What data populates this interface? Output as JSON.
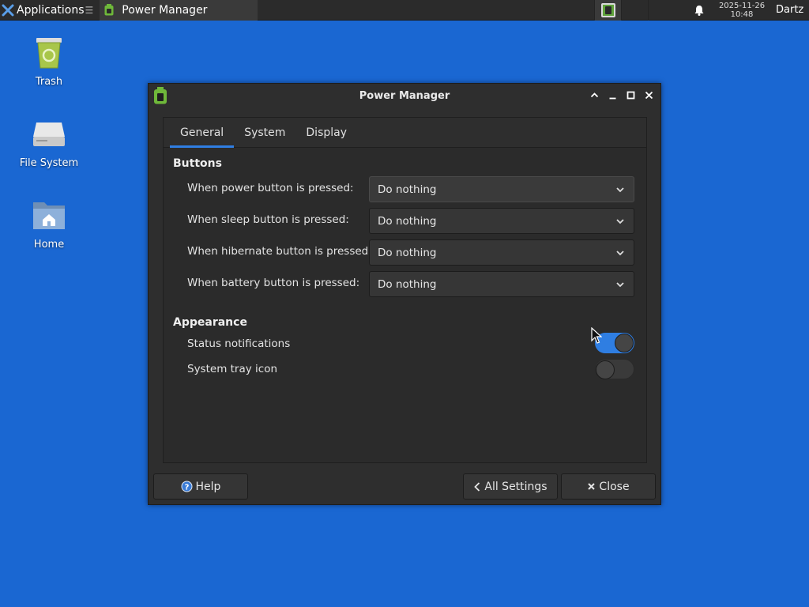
{
  "panel": {
    "applications_label": "Applications",
    "task_title": "Power Manager",
    "clock_date": "2025-11-26",
    "clock_time": "10:48",
    "user_name": "Dartz"
  },
  "desktop": {
    "icons": [
      {
        "label": "Trash"
      },
      {
        "label": "File System"
      },
      {
        "label": "Home"
      }
    ]
  },
  "window": {
    "title": "Power Manager",
    "tabs": [
      {
        "label": "General",
        "active": true
      },
      {
        "label": "System",
        "active": false
      },
      {
        "label": "Display",
        "active": false
      }
    ],
    "sections": {
      "buttons": {
        "title": "Buttons",
        "rows": [
          {
            "label": "When power button is pressed:",
            "value": "Do nothing"
          },
          {
            "label": "When sleep button is pressed:",
            "value": "Do nothing"
          },
          {
            "label": "When hibernate button is pressed:",
            "value": "Do nothing"
          },
          {
            "label": "When battery button is pressed:",
            "value": "Do nothing"
          }
        ]
      },
      "appearance": {
        "title": "Appearance",
        "rows": [
          {
            "label": "Status notifications",
            "enabled": true
          },
          {
            "label": "System tray icon",
            "enabled": false
          }
        ]
      }
    },
    "footer": {
      "help_label": "Help",
      "all_settings_label": "All Settings",
      "close_label": "Close"
    }
  },
  "colors": {
    "desktop_bg": "#1a67d2",
    "accent": "#2f7ee2",
    "window_bg": "#2e2e2e"
  }
}
